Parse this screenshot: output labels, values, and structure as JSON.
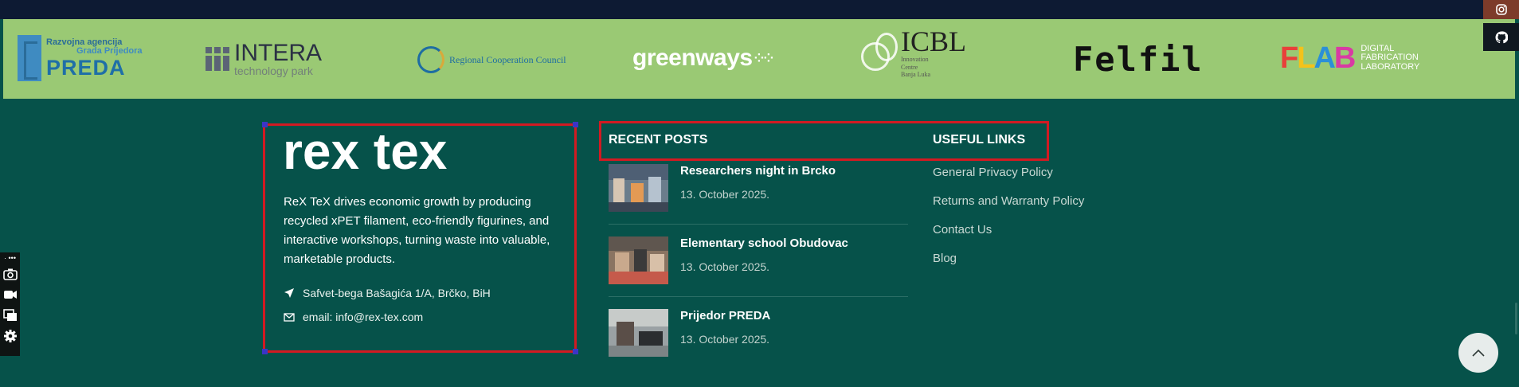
{
  "partners": {
    "preda": {
      "line1": "Razvojna agencija",
      "line2": "Grada Prijedora",
      "name": "PREDA"
    },
    "intera": {
      "name": "INTERA",
      "sub": "technology park"
    },
    "regional": {
      "text": "Regional Cooperation Council"
    },
    "greenways": {
      "name": "greenways"
    },
    "icbl": {
      "name": "ICBL",
      "line1": "Innovation",
      "line2": "Centre",
      "line3": "Banja Luka"
    },
    "felfil": {
      "name": "Felfil"
    },
    "flab": {
      "letters": "FLAB",
      "line1": "DIGITAL",
      "line2": "FABRICATION",
      "line3": "LABORATORY"
    }
  },
  "about": {
    "logo_text": "rex tex",
    "description": "ReX TeX drives economic growth by producing recycled xPET filament, eco-friendly figurines, and interactive workshops, turning waste into valuable, marketable products.",
    "address": "Safvet-bega Bašagića 1/A, Brčko, BiH",
    "email": "email: info@rex-tex.com"
  },
  "recent_posts": {
    "title": "RECENT POSTS",
    "items": [
      {
        "title": "Researchers night in Brcko",
        "date": "13. October 2025."
      },
      {
        "title": "Elementary school Obudovac",
        "date": "13. October 2025."
      },
      {
        "title": "Prijedor PREDA",
        "date": "13. October 2025."
      }
    ]
  },
  "useful_links": {
    "title": "USEFUL LINKS",
    "items": [
      {
        "label": "General Privacy Policy"
      },
      {
        "label": "Returns and Warranty Policy"
      },
      {
        "label": "Contact Us"
      },
      {
        "label": "Blog"
      }
    ]
  },
  "icons": {
    "social": [
      "instagram-icon",
      "github-icon"
    ],
    "tools": [
      "camera-icon",
      "video-icon",
      "window-icon",
      "gear-icon"
    ],
    "scroll": "chevron-up-icon",
    "address": "location-arrow-icon",
    "email": "envelope-icon"
  },
  "colors": {
    "footer_bg": "#06524a",
    "partner_band": "#9ac974",
    "top_bar": "#0d1a33",
    "highlight": "#d21a22"
  }
}
